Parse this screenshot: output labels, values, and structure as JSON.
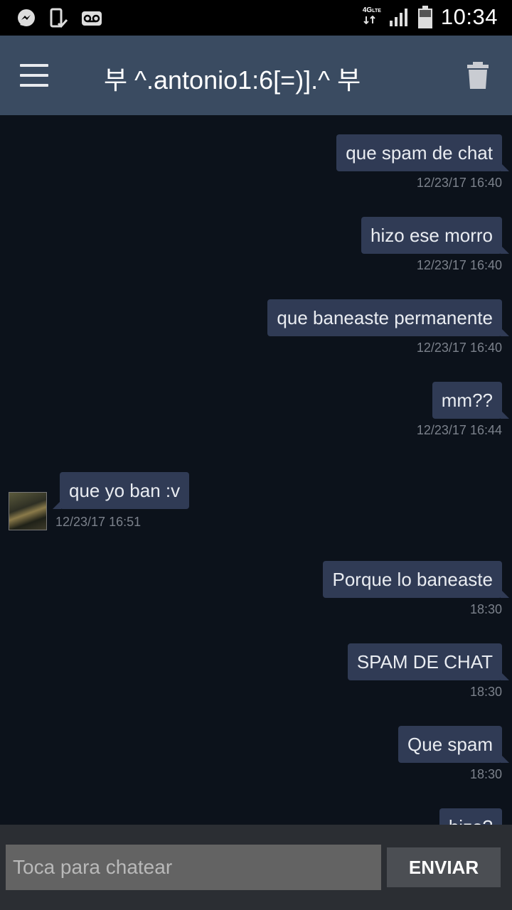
{
  "status_bar": {
    "time": "10:34",
    "network": "4G",
    "network_sub": "LTE",
    "icons": [
      "messenger-icon",
      "phone-check-icon",
      "voicemail-icon",
      "network-arrows-icon",
      "signal-icon",
      "battery-icon"
    ]
  },
  "app_bar": {
    "title": "부 ^.antonio1:6[=)].^ 부",
    "menu_icon": "hamburger-menu-icon",
    "delete_icon": "trash-icon",
    "background": "#3a4b61"
  },
  "messages": [
    {
      "text": "que spam de chat",
      "time": "12/23/17 16:40",
      "direction": "out"
    },
    {
      "text": "hizo ese morro",
      "time": "12/23/17 16:40",
      "direction": "out"
    },
    {
      "text": "que baneaste permanente",
      "time": "12/23/17 16:40",
      "direction": "out"
    },
    {
      "text": "mm??",
      "time": "12/23/17 16:44",
      "direction": "out"
    },
    {
      "text": "que yo ban :v",
      "time": "12/23/17 16:51",
      "direction": "in"
    },
    {
      "text": "Porque lo baneaste",
      "time": "18:30",
      "direction": "out"
    },
    {
      "text": "SPAM DE CHAT",
      "time": "18:30",
      "direction": "out"
    },
    {
      "text": "Que spam",
      "time": "18:30",
      "direction": "out"
    },
    {
      "text": "hizo?",
      "time": "",
      "direction": "out"
    }
  ],
  "input_bar": {
    "placeholder": "Toca para chatear",
    "value": "",
    "send_label": "ENVIAR"
  },
  "colors": {
    "chat_background": "#0c121b",
    "bubble": "#303b55",
    "timestamp": "#7b818b"
  }
}
